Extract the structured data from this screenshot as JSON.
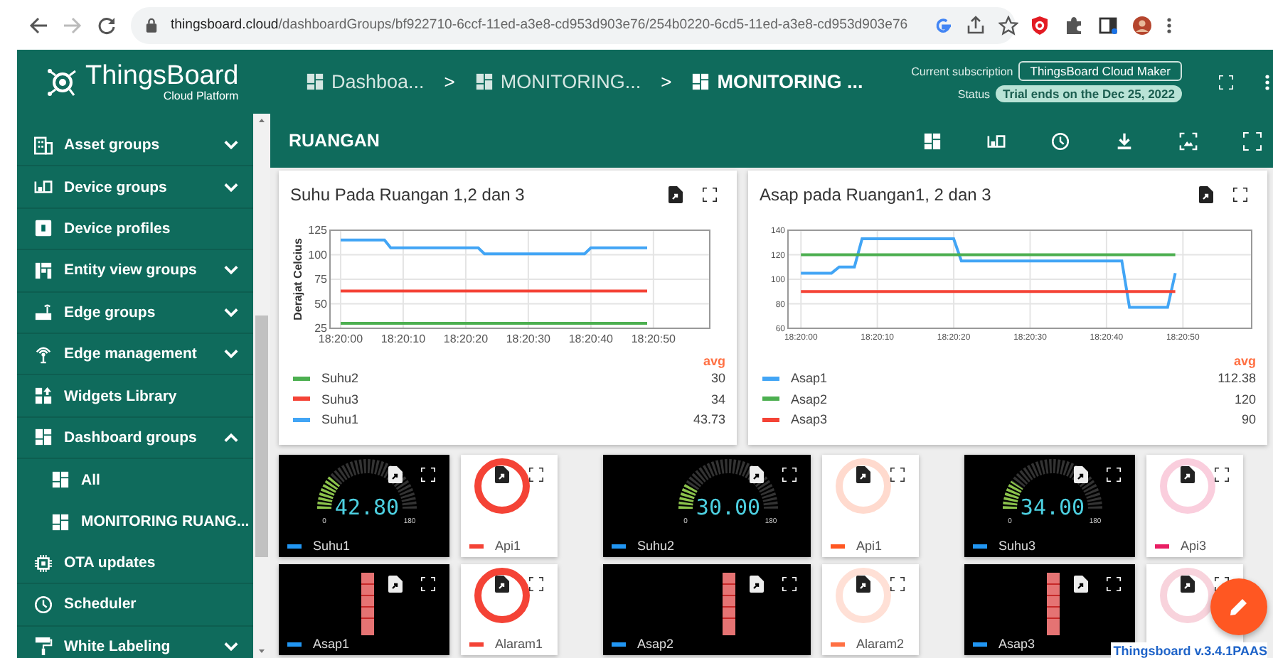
{
  "browser": {
    "url_domain": "thingsboard.cloud",
    "url_path": "/dashboardGroups/bf922710-6ccf-11ed-a3e8-cd953d903e76/254b0220-6cd5-11ed-a3e8-cd953d903e76"
  },
  "header": {
    "logo_title": "ThingsBoard",
    "logo_subtitle": "Cloud Platform",
    "breadcrumbs": [
      {
        "label": "Dashboa...",
        "selected": false
      },
      {
        "label": "MONITORING...",
        "selected": false
      },
      {
        "label": "MONITORING ...",
        "selected": true
      }
    ],
    "separators": [
      ">",
      ">"
    ],
    "subscription_label": "Current subscription",
    "subscription": "ThingsBoard Cloud Maker",
    "status_label": "Status",
    "status": "Trial ends on the Dec 25, 2022"
  },
  "sidebar": {
    "items": [
      {
        "label": "Asset groups",
        "kind": "group",
        "expanded": false
      },
      {
        "label": "Device groups",
        "kind": "group",
        "expanded": false
      },
      {
        "label": "Device profiles",
        "kind": "link"
      },
      {
        "label": "Entity view groups",
        "kind": "group",
        "expanded": false
      },
      {
        "label": "Edge groups",
        "kind": "group",
        "expanded": false
      },
      {
        "label": "Edge management",
        "kind": "group",
        "expanded": false
      },
      {
        "label": "Widgets Library",
        "kind": "link"
      },
      {
        "label": "Dashboard groups",
        "kind": "group",
        "expanded": true,
        "children": [
          {
            "label": "All"
          },
          {
            "label": "MONITORING RUANG..."
          }
        ]
      },
      {
        "label": "OTA updates",
        "kind": "link"
      },
      {
        "label": "Scheduler",
        "kind": "link"
      },
      {
        "label": "White Labeling",
        "kind": "group",
        "expanded": false
      }
    ]
  },
  "dashboard": {
    "title": "RUANGAN"
  },
  "charts": [
    {
      "title": "Suhu Pada Ruangan 1,2 dan 3",
      "chart_data": {
        "type": "line",
        "ylabel": "Derajat Celcius",
        "categories": [
          "18:20:00",
          null,
          null,
          null,
          null,
          null,
          null,
          null,
          null,
          null,
          "18:20:10",
          null,
          null,
          null,
          null,
          null,
          null,
          null,
          null,
          null,
          "18:20:20",
          null,
          null,
          null,
          null,
          null,
          null,
          null,
          null,
          null,
          "18:20:30",
          null,
          null,
          null,
          null,
          null,
          null,
          null,
          null,
          null,
          "18:20:40",
          null,
          null,
          null,
          null,
          null,
          null,
          null,
          null,
          null,
          "18:20:50"
        ],
        "series": [
          {
            "name": "Suhu2",
            "color": "#4caf50",
            "values": [
              30,
              30,
              30,
              30,
              30,
              30,
              30,
              30,
              30,
              30,
              30,
              30,
              30,
              30,
              30,
              30,
              30,
              30,
              30,
              30,
              30,
              30,
              30,
              30,
              30,
              30,
              30,
              30,
              30,
              30,
              30,
              30,
              30,
              30,
              30,
              30,
              30,
              30,
              30,
              30,
              30,
              30,
              30,
              30,
              30,
              30,
              30,
              30,
              30,
              30,
              null
            ]
          },
          {
            "name": "Suhu3",
            "color": "#f44336",
            "values": [
              63,
              63,
              63,
              63,
              63,
              63,
              63,
              63,
              63,
              63,
              63,
              63,
              63,
              63,
              63,
              63,
              63,
              63,
              63,
              63,
              63,
              63,
              63,
              63,
              63,
              63,
              63,
              63,
              63,
              63,
              63,
              63,
              63,
              63,
              63,
              63,
              63,
              63,
              63,
              63,
              63,
              63,
              63,
              63,
              63,
              63,
              63,
              63,
              63,
              63,
              null
            ]
          },
          {
            "name": "Suhu1",
            "color": "#42a5f5",
            "values": [
              115,
              115,
              115,
              115,
              115,
              115,
              115,
              115,
              107,
              107,
              107,
              107,
              107,
              107,
              107,
              107,
              107,
              107,
              107,
              107,
              107,
              107,
              107,
              101,
              101,
              101,
              101,
              101,
              101,
              101,
              101,
              101,
              101,
              101,
              101,
              101,
              101,
              101,
              101,
              101,
              107,
              107,
              107,
              107,
              107,
              107,
              107,
              107,
              107,
              107,
              null
            ]
          }
        ],
        "grid": true,
        "ylim": [
          25,
          125
        ],
        "yticks": [
          25,
          50,
          75,
          100,
          125
        ]
      },
      "legend": {
        "header": "avg",
        "values": [
          "30",
          "34",
          "43.73"
        ]
      }
    },
    {
      "title": "Asap pada Ruangan1, 2 dan 3",
      "chart_data": {
        "type": "line",
        "categories": [
          "18:20:00",
          null,
          null,
          null,
          null,
          null,
          null,
          null,
          null,
          null,
          "18:20:10",
          null,
          null,
          null,
          null,
          null,
          null,
          null,
          null,
          null,
          "18:20:20",
          null,
          null,
          null,
          null,
          null,
          null,
          null,
          null,
          null,
          "18:20:30",
          null,
          null,
          null,
          null,
          null,
          null,
          null,
          null,
          null,
          "18:20:40",
          null,
          null,
          null,
          null,
          null,
          null,
          null,
          null,
          null,
          "18:20:50"
        ],
        "series": [
          {
            "name": "Asap1",
            "color": "#42a5f5",
            "values": [
              105,
              105,
              105,
              105,
              105,
              110,
              110,
              110,
              133,
              133,
              133,
              133,
              133,
              133,
              133,
              133,
              133,
              133,
              133,
              133,
              133,
              115,
              115,
              115,
              115,
              115,
              115,
              115,
              115,
              115,
              115,
              115,
              115,
              115,
              115,
              115,
              115,
              115,
              115,
              115,
              115,
              115,
              115,
              77,
              77,
              77,
              77,
              77,
              77,
              105,
              null
            ]
          },
          {
            "name": "Asap2",
            "color": "#4caf50",
            "values": [
              120,
              120,
              120,
              120,
              120,
              120,
              120,
              120,
              120,
              120,
              120,
              120,
              120,
              120,
              120,
              120,
              120,
              120,
              120,
              120,
              120,
              120,
              120,
              120,
              120,
              120,
              120,
              120,
              120,
              120,
              120,
              120,
              120,
              120,
              120,
              120,
              120,
              120,
              120,
              120,
              120,
              120,
              120,
              120,
              120,
              120,
              120,
              120,
              120,
              120,
              null
            ]
          },
          {
            "name": "Asap3",
            "color": "#f44336",
            "values": [
              90,
              90,
              90,
              90,
              90,
              90,
              90,
              90,
              90,
              90,
              90,
              90,
              90,
              90,
              90,
              90,
              90,
              90,
              90,
              90,
              90,
              90,
              90,
              90,
              90,
              90,
              90,
              90,
              90,
              90,
              90,
              90,
              90,
              90,
              90,
              90,
              90,
              90,
              90,
              90,
              90,
              90,
              90,
              90,
              90,
              90,
              90,
              90,
              90,
              90,
              null
            ]
          }
        ],
        "grid": true,
        "ylim": [
          60,
          140
        ],
        "yticks": [
          60,
          80,
          100,
          120,
          140
        ]
      },
      "legend": {
        "header": "avg",
        "values": [
          "112.38",
          "120",
          "90"
        ]
      }
    }
  ],
  "widgets": [
    {
      "kind": "gauge",
      "value": "42.80",
      "min": "0",
      "max": "180",
      "label": "Suhu1",
      "color": "#2196f3"
    },
    {
      "kind": "donut",
      "on": true,
      "label": "Api1",
      "color": "#f44336"
    },
    {
      "kind": "gauge",
      "value": "30.00",
      "min": "0",
      "max": "180",
      "label": "Suhu2",
      "color": "#2196f3"
    },
    {
      "kind": "donut",
      "on": false,
      "label": "Api1",
      "color": "#ff5722"
    },
    {
      "kind": "gauge",
      "value": "34.00",
      "min": "0",
      "max": "180",
      "label": "Suhu3",
      "color": "#2196f3"
    },
    {
      "kind": "donut",
      "on": false,
      "label": "Api3",
      "color": "#e91e63"
    },
    {
      "kind": "bar",
      "label": "Asap1",
      "color": "#2196f3"
    },
    {
      "kind": "donut",
      "on": true,
      "label": "Alaram1",
      "color": "#f44336"
    },
    {
      "kind": "bar",
      "label": "Asap2",
      "color": "#2196f3"
    },
    {
      "kind": "donut",
      "on": false,
      "label": "Alaram2",
      "color": "#ff7043"
    },
    {
      "kind": "bar",
      "label": "Asap3",
      "color": "#2196f3"
    },
    {
      "kind": "donut",
      "on": false
    }
  ],
  "footer": {
    "version": "Thingsboard v.3.4.1PAAS"
  }
}
